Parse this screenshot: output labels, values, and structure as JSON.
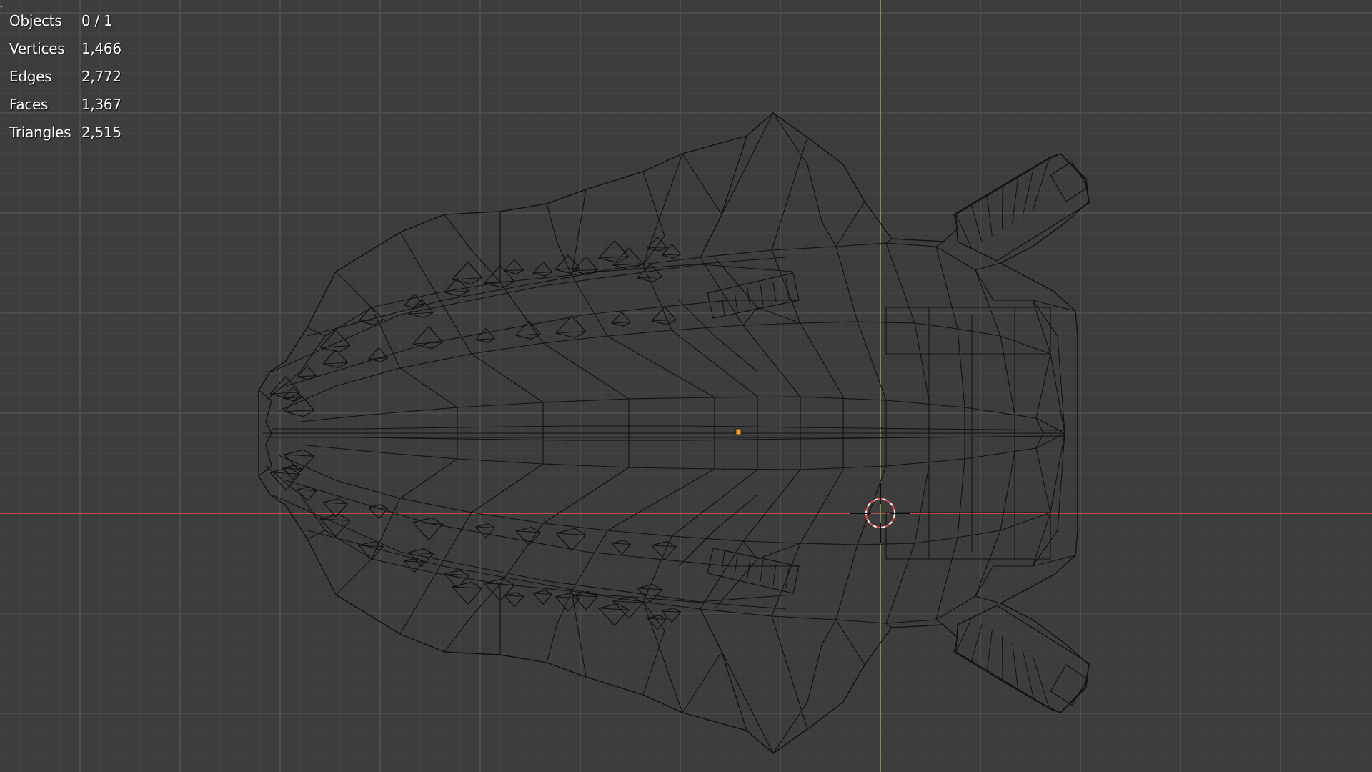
{
  "app": {
    "view": "3D Viewport",
    "shading": "Wireframe"
  },
  "colors": {
    "background": "#3d3d3d",
    "grid_minor": "#454545",
    "grid_major": "#505050",
    "axis_x": "#c44a4a",
    "axis_y": "#6f9a3a",
    "wire": "#121212",
    "origin": "#f2a23a",
    "cursor_red": "#e04848",
    "cursor_white": "#f0f0f0",
    "text": "#ffffff"
  },
  "statistics": [
    {
      "label": "Objects",
      "value": "0 / 1"
    },
    {
      "label": "Vertices",
      "value": "1,466"
    },
    {
      "label": "Edges",
      "value": "2,772"
    },
    {
      "label": "Faces",
      "value": "1,367"
    },
    {
      "label": "Triangles",
      "value": "2,515"
    }
  ],
  "icons": {
    "corner": "collapse-arrow-icon",
    "cursor": "3d-cursor-icon",
    "origin": "object-origin-icon"
  }
}
